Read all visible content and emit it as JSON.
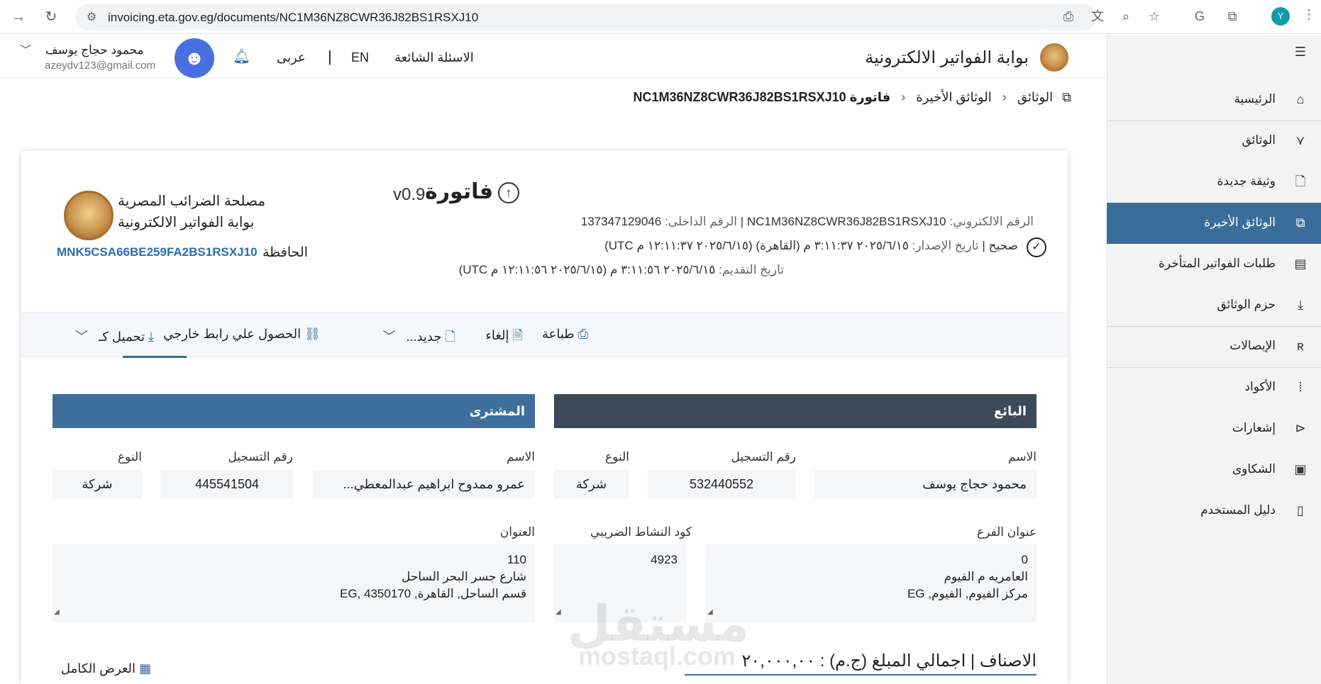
{
  "browser": {
    "url": "invoicing.eta.gov.eg/documents/NC1M36NZ8CWR36J82BS1RSXJ10",
    "profile_initial": "Y"
  },
  "header": {
    "portal_title": "بوابة الفواتير الالكترونية",
    "faq": "الاسئلة الشائعة",
    "lang_en": "EN",
    "lang_sep": "|",
    "lang_ar": "عربى",
    "user_name": "محمود حجاج يوسف",
    "user_email": "azeydv123@gmail.com"
  },
  "sidebar": {
    "items": [
      {
        "label": "الرئيسية",
        "icon": "home-icon"
      },
      {
        "label": "الوثائق",
        "icon": "documents-icon"
      },
      {
        "label": "وثيقة جديدة",
        "icon": "new-document-icon"
      },
      {
        "label": "الوثائق الأخيرة",
        "icon": "recent-documents-icon"
      },
      {
        "label": "طلبات الفواتير المتأخرة",
        "icon": "late-requests-icon"
      },
      {
        "label": "حزم الوثائق",
        "icon": "download-icon"
      },
      {
        "label": "الإيصالات",
        "icon": "receipts-icon"
      },
      {
        "label": "الأكواد",
        "icon": "codes-icon"
      },
      {
        "label": "إشعارات",
        "icon": "notifications-icon"
      },
      {
        "label": "الشكاوى",
        "icon": "complaints-icon"
      },
      {
        "label": "دليل المستخدم",
        "icon": "user-guide-icon"
      }
    ]
  },
  "breadcrumb": {
    "root": "الوثائق",
    "recent": "الوثائق الأخيرة",
    "current": "فاتورة NC1M36NZ8CWR36J82BS1RSXJ10"
  },
  "document": {
    "type": "فاتورة",
    "version": "v0.9",
    "uuid_label": "الرقم الالكتروني:",
    "uuid": "NC1M36NZ8CWR36J82BS1RSXJ10",
    "internal_label": "الرقم الداخلى:",
    "internal_id": "137347129046",
    "status": "صحيح",
    "issue_label": "تاريخ الإصدار:",
    "issue_date": "٢٠٢٥/٦/١٥ ٣:١١:٣٧ م (القاهرة) (٢٠٢٥/٦/١٥ ١٢:١١:٣٧ م UTC)",
    "submit_label": "تاريخ التقديم:",
    "submit_date": "٢٠٢٥/٦/١٥ ٣:١١:٥٦ م (٢٠٢٥/٦/١٥ ١٢:١١:٥٦ م UTC)",
    "authority_name": "مصلحة الضرائب المصرية",
    "authority_portal": "بوابة الفواتير الالكترونية",
    "wallet_label": "الحافظة",
    "wallet_code": "MNK5CSA66BE259FA2BS1RSXJ10"
  },
  "toolbar": {
    "print": "طباعة",
    "cancel": "إلغاء",
    "new": "جديد...",
    "external_link": "الحصول علي رابط خارجي",
    "download": "تحميل كـ"
  },
  "seller": {
    "title": "البائع",
    "name_label": "الاسم",
    "name": "محمود حجاج يوسف",
    "reg_label": "رقم التسجيل",
    "reg": "532440552",
    "type_label": "النوع",
    "type": "شركة",
    "branch_label": "عنوان الفرع",
    "branch_lines": [
      "0",
      "العامريه م الفيوم",
      "مركز الفيوم, الفيوم, EG"
    ],
    "activity_label": "كود النشاط الضريبي",
    "activity": "4923"
  },
  "buyer": {
    "title": "المشترى",
    "name_label": "الاسم",
    "name": "عمرو ممدوح ابراهيم عبدالمعطي...",
    "reg_label": "رقم التسجيل",
    "reg": "445541504",
    "type_label": "النوع",
    "type": "شركة",
    "address_label": "العنوان",
    "address_lines": [
      "110",
      "شارع جسر البحر الساحل",
      "قسم الساحل, القاهرة, EG, 4350170"
    ]
  },
  "items": {
    "title": "الاصناف | اجمالي المبلغ (ج.م) : ٢٠,٠٠٠,٠٠",
    "full_view": "العرض الكامل"
  },
  "watermark": {
    "main": "مستقل",
    "sub": "mostaql.com"
  }
}
